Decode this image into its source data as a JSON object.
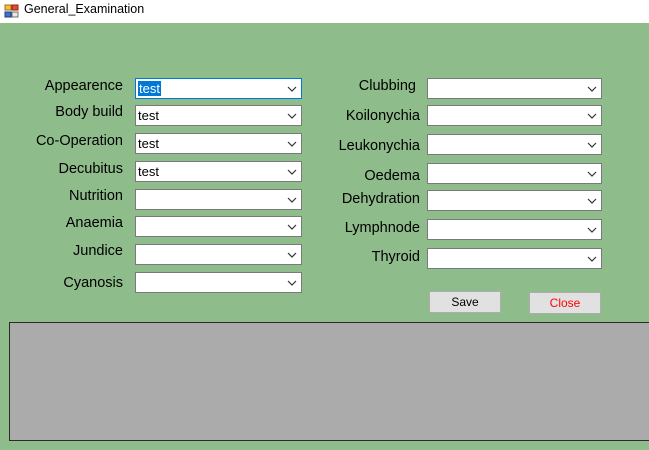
{
  "window": {
    "title": "General_Examination"
  },
  "left_fields": [
    {
      "label": "Appearence",
      "value": "test"
    },
    {
      "label": "Body build",
      "value": "test"
    },
    {
      "label": "Co-Operation",
      "value": "test"
    },
    {
      "label": "Decubitus",
      "value": "test"
    },
    {
      "label": "Nutrition",
      "value": ""
    },
    {
      "label": "Anaemia",
      "value": ""
    },
    {
      "label": "Jundice",
      "value": ""
    },
    {
      "label": "Cyanosis",
      "value": ""
    }
  ],
  "right_fields": [
    {
      "label": "Clubbing",
      "value": ""
    },
    {
      "label": "Koilonychia",
      "value": ""
    },
    {
      "label": "Leukonychia",
      "value": ""
    },
    {
      "label": "Oedema",
      "value": ""
    },
    {
      "label": "Dehydration",
      "value": ""
    },
    {
      "label": "Lymphnode",
      "value": ""
    },
    {
      "label": "Thyroid",
      "value": ""
    }
  ],
  "buttons": {
    "save": "Save",
    "close": "Close"
  },
  "colors": {
    "background": "#8fbc8b",
    "grid": "#ababab",
    "selection": "#0078d7",
    "close_text": "#ff0000"
  }
}
